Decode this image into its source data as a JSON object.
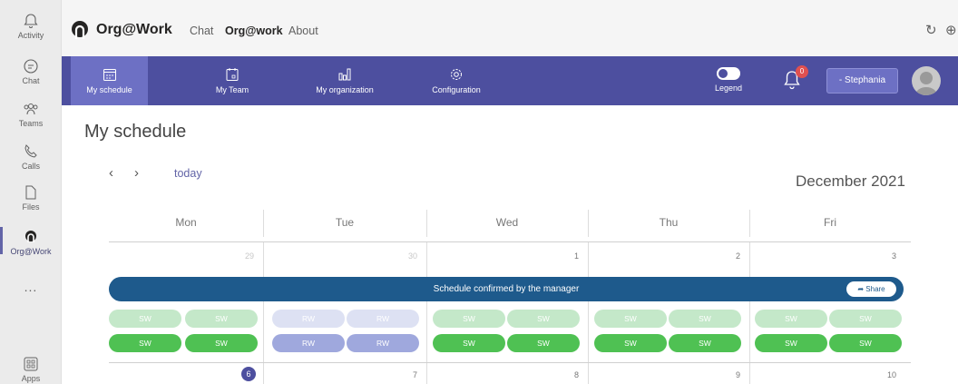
{
  "rail": [
    {
      "label": "Activity",
      "icon": "bell-icon"
    },
    {
      "label": "Chat",
      "icon": "chat-icon"
    },
    {
      "label": "Teams",
      "icon": "teams-icon"
    },
    {
      "label": "Calls",
      "icon": "phone-icon"
    },
    {
      "label": "Files",
      "icon": "file-icon"
    },
    {
      "label": "Org@Work",
      "icon": "orgwork-icon"
    },
    {
      "label": "...",
      "icon": "more-icon"
    },
    {
      "label": "Apps",
      "icon": "apps-icon"
    }
  ],
  "header": {
    "app_name": "Org@Work",
    "tabs": [
      "Chat",
      "Org@work",
      "About"
    ]
  },
  "nav": {
    "items": [
      "My schedule",
      "My Team",
      "My organization",
      "Configuration"
    ],
    "legend": "Legend",
    "notification_count": "0",
    "user": "- Stephania",
    "accent": "#4d4f9f"
  },
  "main": {
    "title": "My schedule",
    "prev": "‹",
    "next": "›",
    "today": "today",
    "month": "December 2021",
    "days": [
      "Mon",
      "Tue",
      "Wed",
      "Thu",
      "Fri"
    ],
    "week1_dates": [
      "29",
      "30",
      "1",
      "2",
      "3"
    ],
    "banner": "Schedule confirmed by the manager",
    "share": "Share",
    "shifts": {
      "row1": [
        [
          "SW",
          "SW"
        ],
        [
          "RW",
          "RW"
        ],
        [
          "SW",
          "SW"
        ],
        [
          "SW",
          "SW"
        ],
        [
          "SW",
          "SW"
        ]
      ],
      "row2": [
        [
          "SW",
          "SW"
        ],
        [
          "RW",
          "RW"
        ],
        [
          "SW",
          "SW"
        ],
        [
          "SW",
          "SW"
        ],
        [
          "SW",
          "SW"
        ]
      ]
    },
    "week2_dates": [
      "6",
      "7",
      "8",
      "9",
      "10"
    ]
  }
}
